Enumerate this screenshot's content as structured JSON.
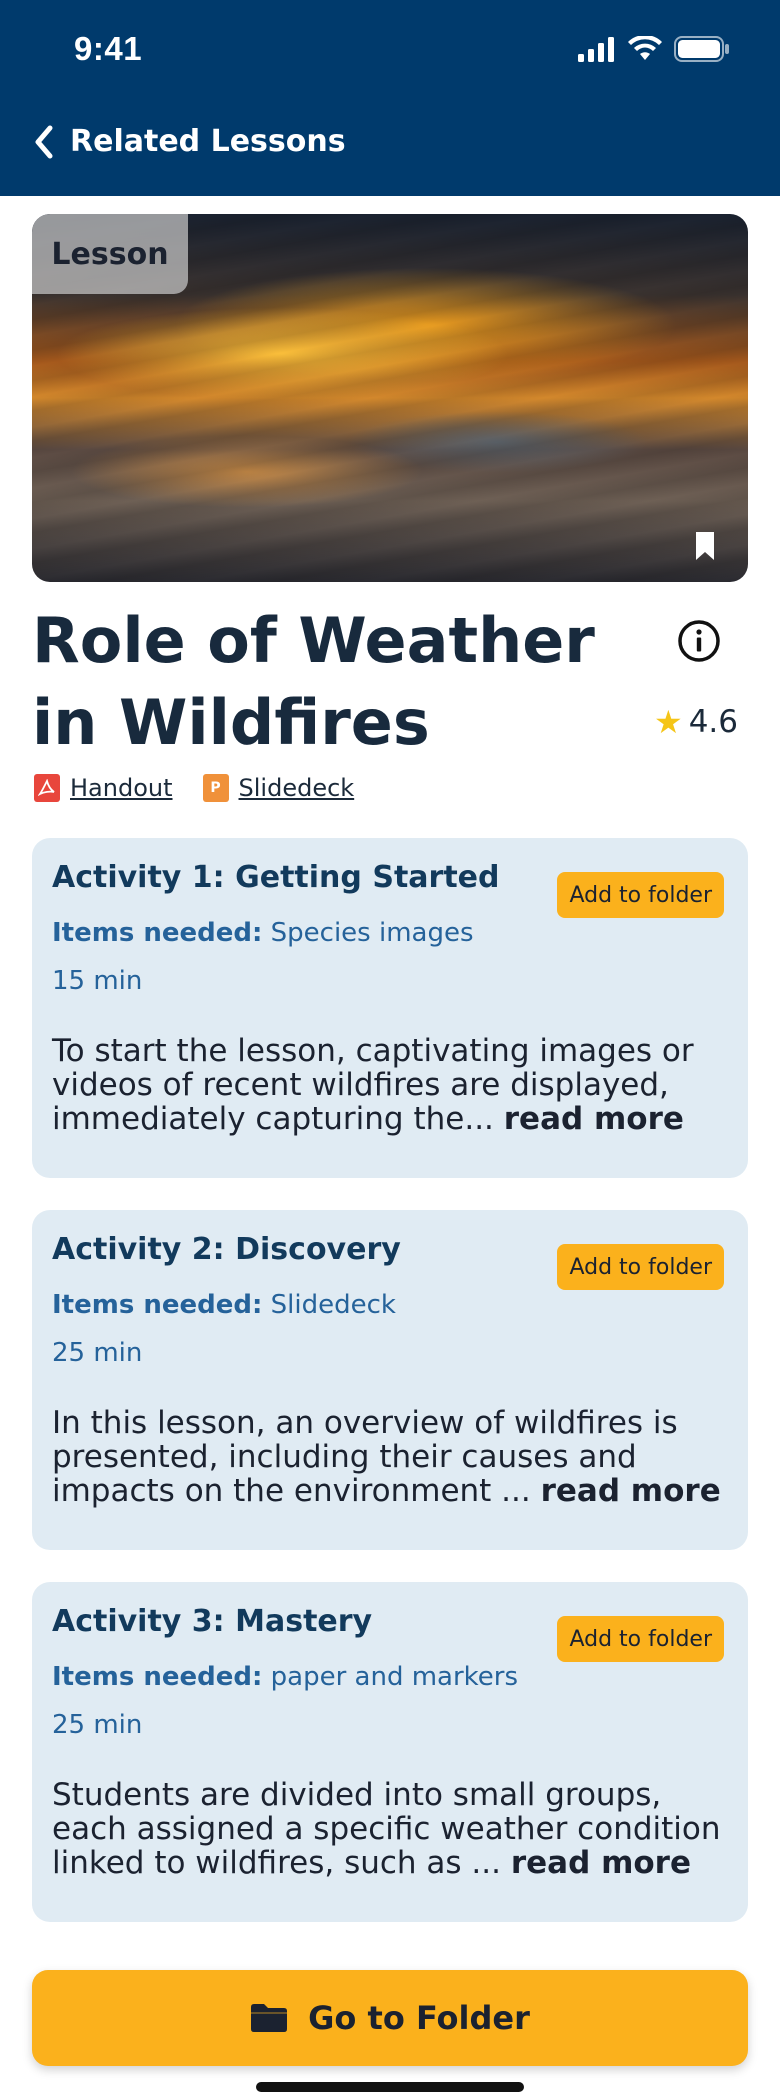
{
  "status_bar": {
    "time": "9:41"
  },
  "nav": {
    "title": "Related Lessons"
  },
  "hero": {
    "tag": "Lesson"
  },
  "lesson": {
    "title": "Role of Weather in Wildfires",
    "rating": "4.6",
    "resources": [
      {
        "label": "Handout",
        "type": "pdf",
        "icon": "pdf-file-icon"
      },
      {
        "label": "Slidedeck",
        "type": "ppt",
        "icon": "ppt-file-icon"
      }
    ]
  },
  "activities": [
    {
      "title": "Activity 1: Getting Started",
      "add_label": "Add to folder",
      "items_label": "Items needed:",
      "items": "Species images",
      "duration": "15 min",
      "description": "To start the lesson, captivating images or videos of recent wildfires are displayed, immediately capturing the...",
      "read_more": "read more"
    },
    {
      "title": "Activity 2: Discovery",
      "add_label": "Add to folder",
      "items_label": "Items needed:",
      "items": "Slidedeck",
      "duration": "25 min",
      "description": "In this lesson, an overview of wildfires is presented, including their causes and impacts on the environment ...",
      "read_more": "read more"
    },
    {
      "title": "Activity 3: Mastery",
      "add_label": "Add to folder",
      "items_label": "Items needed:",
      "items": "paper and markers",
      "duration": "25 min",
      "description": "Students are divided into small groups, each assigned a specific weather condition linked to wildfires, such as ...",
      "read_more": "read more"
    }
  ],
  "footer": {
    "button_label": "Go to Folder"
  },
  "colors": {
    "header": "#003a6c",
    "accent": "#fbb11c",
    "card": "#e0ebf3",
    "link_blue": "#25629a"
  }
}
